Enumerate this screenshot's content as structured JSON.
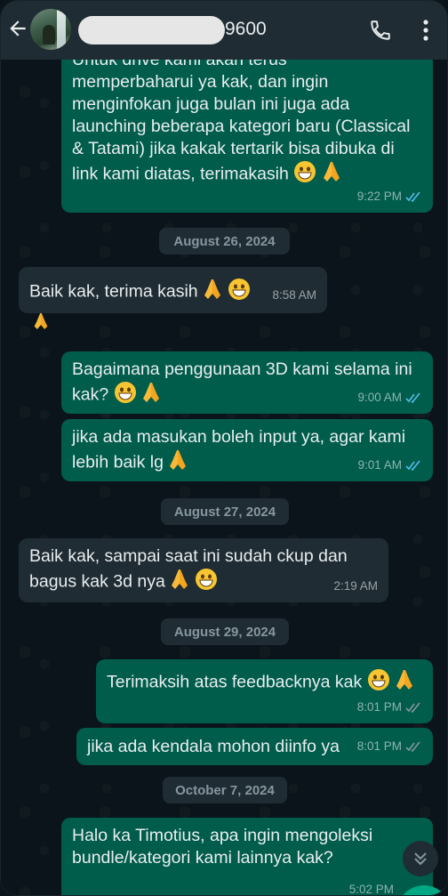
{
  "header": {
    "back_icon": "arrow-left-icon",
    "contact_name_suffix": "9600",
    "call_icon": "phone-icon",
    "menu_icon": "more-vert-icon"
  },
  "messages": [
    {
      "type": "out",
      "text_lines": [
        "Untuk drive kami akan terus",
        "memperbaharui ya kak, dan ingin",
        "menginfokan juga bulan ini juga ada",
        "launching beberapa kategori baru (Classical",
        "& Tatami) jika kakak tertarik bisa dibuka di",
        "link kami diatas, terimakasih"
      ],
      "time": "9:22 PM"
    },
    {
      "type": "date",
      "text": "August 26, 2024"
    },
    {
      "type": "in",
      "text": "Baik kak, terima kasih",
      "time": "8:58 AM"
    },
    {
      "type": "out",
      "text_lines": [
        "Bagaimana penggunaan 3D kami selama ini",
        "kak?"
      ],
      "time": "9:00 AM"
    },
    {
      "type": "out",
      "text_lines": [
        "jika ada masukan boleh input ya, agar kami",
        "lebih baik lg"
      ],
      "time": "9:01 AM"
    },
    {
      "type": "date",
      "text": "August 27, 2024"
    },
    {
      "type": "in",
      "text_lines": [
        "Baik kak, sampai saat ini sudah ckup dan",
        "bagus kak 3d nya"
      ],
      "time": "2:19 AM"
    },
    {
      "type": "date",
      "text": "August 29, 2024"
    },
    {
      "type": "out",
      "text": "Terimaksih atas feedbacknya kak",
      "time": "8:01 PM"
    },
    {
      "type": "out",
      "text": "jika ada kendala mohon diinfo ya",
      "time": "8:01 PM"
    },
    {
      "type": "date",
      "text": "October 7, 2024"
    },
    {
      "type": "out",
      "text_lines": [
        "Halo ka Timotius, apa ingin mengoleksi",
        "bundle/kategori kami lainnya kak?"
      ],
      "time": "5:02 PM"
    }
  ],
  "colors": {
    "outgoing": "#005c4b",
    "incoming": "#1f2c33",
    "read_ticks": "#53bdeb",
    "grey_ticks": "#8696a0"
  },
  "scroll_down_icon": "double-chevron-down-icon"
}
